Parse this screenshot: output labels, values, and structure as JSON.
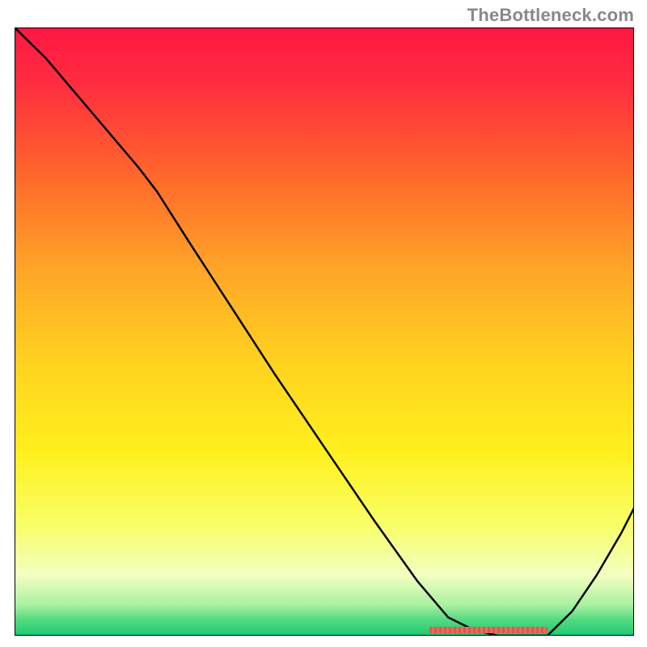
{
  "watermark": "TheBottleneck.com",
  "gradient_stops": [
    {
      "offset": 0.0,
      "color": "#ff1744"
    },
    {
      "offset": 0.1,
      "color": "#ff2f3e"
    },
    {
      "offset": 0.25,
      "color": "#ff6a2a"
    },
    {
      "offset": 0.4,
      "color": "#ffa628"
    },
    {
      "offset": 0.55,
      "color": "#ffd21f"
    },
    {
      "offset": 0.7,
      "color": "#fff01e"
    },
    {
      "offset": 0.82,
      "color": "#f8ff6a"
    },
    {
      "offset": 0.9,
      "color": "#f3ffc0"
    },
    {
      "offset": 0.95,
      "color": "#a8f0a0"
    },
    {
      "offset": 0.975,
      "color": "#4fd980"
    },
    {
      "offset": 1.0,
      "color": "#1fc873"
    }
  ],
  "chart_data": {
    "type": "line",
    "title": "",
    "xlabel": "",
    "ylabel": "",
    "xlim": [
      0,
      100
    ],
    "ylim": [
      0,
      100
    ],
    "grid": false,
    "legend": false,
    "optimal_range_x": [
      67,
      86
    ],
    "series": [
      {
        "name": "bottleneck-curve",
        "x": [
          0,
          5,
          10,
          15,
          20,
          23,
          28,
          35,
          42,
          50,
          58,
          65,
          70,
          74,
          78,
          82,
          86,
          90,
          94,
          98,
          100
        ],
        "y": [
          100,
          95,
          89,
          83,
          77,
          73,
          65,
          54,
          43,
          31,
          19,
          9,
          3,
          1,
          0,
          0,
          0,
          4,
          10,
          17,
          21
        ]
      }
    ]
  }
}
